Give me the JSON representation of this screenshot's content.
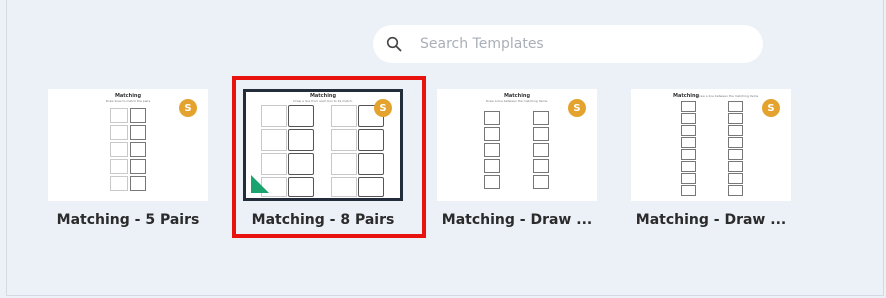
{
  "search": {
    "placeholder": "Search Templates"
  },
  "templates": [
    {
      "label": "Matching - 5 Pairs",
      "thumb_title": "Matching",
      "thumb_subtitle": "Draw lines to match the pairs",
      "badge": "S"
    },
    {
      "label": "Matching - 8 Pairs",
      "thumb_title": "Matching",
      "thumb_subtitle": "Draw a line from each box to its match.",
      "badge": "S"
    },
    {
      "label": "Matching - Draw ...",
      "thumb_title": "Matching",
      "thumb_subtitle": "Draw a line between the matching items.",
      "badge": "S"
    },
    {
      "label": "Matching - Draw ...",
      "thumb_title": "Matching",
      "thumb_subtitle": "Draw a line between the matching items",
      "badge": "S"
    }
  ],
  "colors": {
    "highlight": "#e8120f",
    "badge": "#e4a22e",
    "corner": "#1aa36f"
  }
}
